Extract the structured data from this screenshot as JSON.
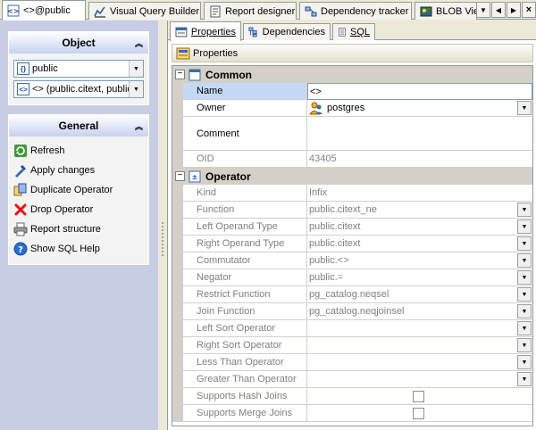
{
  "doc_tabs": [
    {
      "label": "<>@public",
      "icon": "operator-icon",
      "active": true
    },
    {
      "label": "Visual Query Builder",
      "icon": "query-builder-icon",
      "active": false
    },
    {
      "label": "Report designer",
      "icon": "report-icon",
      "active": false
    },
    {
      "label": "Dependency tracker",
      "icon": "dependency-icon",
      "active": false
    },
    {
      "label": "BLOB Vie",
      "icon": "blob-icon",
      "active": false
    }
  ],
  "object_group": {
    "title": "Object",
    "schema_value": "public",
    "operator_value": "<> (public.citext, public"
  },
  "general_group": {
    "title": "General",
    "actions": [
      {
        "label": "Refresh",
        "icon": "refresh-icon"
      },
      {
        "label": "Apply changes",
        "icon": "apply-changes-icon"
      },
      {
        "label": "Duplicate Operator",
        "icon": "duplicate-icon"
      },
      {
        "label": "Drop Operator",
        "icon": "drop-icon"
      },
      {
        "label": "Report structure",
        "icon": "printer-icon"
      },
      {
        "label": "Show SQL Help",
        "icon": "help-icon"
      }
    ]
  },
  "sub_tabs": [
    {
      "label": "Properties",
      "active": true
    },
    {
      "label": "Dependencies",
      "active": false
    },
    {
      "label": "SQL",
      "active": false
    }
  ],
  "toolbar_label": "Properties",
  "categories": {
    "common": "Common",
    "operator": "Operator"
  },
  "common_rows": {
    "name": {
      "label": "Name",
      "value": "<>"
    },
    "owner": {
      "label": "Owner",
      "value": "postgres"
    },
    "comment": {
      "label": "Comment",
      "value": ""
    },
    "oid": {
      "label": "OID",
      "value": "43405"
    }
  },
  "operator_rows": [
    {
      "label": "Kind",
      "value": "Infix",
      "dropdown": false
    },
    {
      "label": "Function",
      "value": "public.citext_ne",
      "dropdown": true
    },
    {
      "label": "Left Operand Type",
      "value": "public.citext",
      "dropdown": true
    },
    {
      "label": "Right Operand Type",
      "value": "public.citext",
      "dropdown": true
    },
    {
      "label": "Commutator",
      "value": "public.<>",
      "dropdown": true
    },
    {
      "label": "Negator",
      "value": "public.=",
      "dropdown": true
    },
    {
      "label": "Restrict Function",
      "value": "pg_catalog.neqsel",
      "dropdown": true
    },
    {
      "label": "Join Function",
      "value": "pg_catalog.neqjoinsel",
      "dropdown": true
    },
    {
      "label": "Left Sort Operator",
      "value": "",
      "dropdown": true
    },
    {
      "label": "Right Sort Operator",
      "value": "",
      "dropdown": true
    },
    {
      "label": "Less Than Operator",
      "value": "",
      "dropdown": true
    },
    {
      "label": "Greater Than Operator",
      "value": "",
      "dropdown": true
    }
  ],
  "checkbox_rows": [
    {
      "label": "Supports Hash Joins",
      "checked": false
    },
    {
      "label": "Supports Merge Joins",
      "checked": false
    }
  ]
}
